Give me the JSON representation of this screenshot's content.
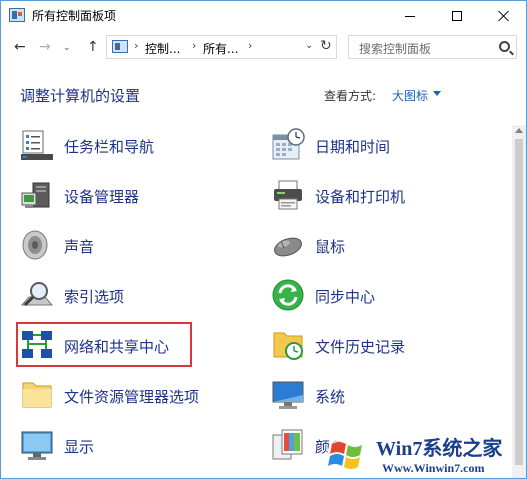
{
  "window": {
    "title": "所有控制面板项",
    "icon": "control-panel-icon",
    "controls": [
      "minimize-icon",
      "maximize-icon",
      "close-icon"
    ]
  },
  "nav": {
    "back_glyph": "←",
    "forward_glyph": "→",
    "history_glyph": "⌄",
    "up_glyph": "↑",
    "breadcrumb": [
      "控制...",
      "所有..."
    ],
    "separator": "›",
    "dropdown_glyph": "⌄",
    "refresh_glyph": "↻",
    "search_placeholder": "搜索控制面板"
  },
  "header": {
    "title": "调整计算机的设置",
    "view_by_label": "查看方式:",
    "view_by_value": "大图标"
  },
  "items": [
    {
      "label": "任务栏和导航",
      "icon": "taskbar-icon"
    },
    {
      "label": "日期和时间",
      "icon": "calendar-clock-icon"
    },
    {
      "label": "设备管理器",
      "icon": "device-manager-icon"
    },
    {
      "label": "设备和打印机",
      "icon": "printer-icon"
    },
    {
      "label": "声音",
      "icon": "speaker-icon"
    },
    {
      "label": "鼠标",
      "icon": "mouse-icon"
    },
    {
      "label": "索引选项",
      "icon": "indexing-icon"
    },
    {
      "label": "同步中心",
      "icon": "sync-icon"
    },
    {
      "label": "网络和共享中心",
      "icon": "network-icon"
    },
    {
      "label": "文件历史记录",
      "icon": "file-history-icon"
    },
    {
      "label": "文件资源管理器选项",
      "icon": "folder-options-icon"
    },
    {
      "label": "系统",
      "icon": "system-icon"
    },
    {
      "label": "显示",
      "icon": "display-icon"
    },
    {
      "label": "颜色",
      "icon": "color-icon"
    }
  ],
  "watermark": {
    "title": "Win7系统之家",
    "url": "Www.Winwin7.com"
  },
  "colors": {
    "link": "#1e3287",
    "accent": "#1c5fb4",
    "highlight_border": "#d9363e"
  }
}
